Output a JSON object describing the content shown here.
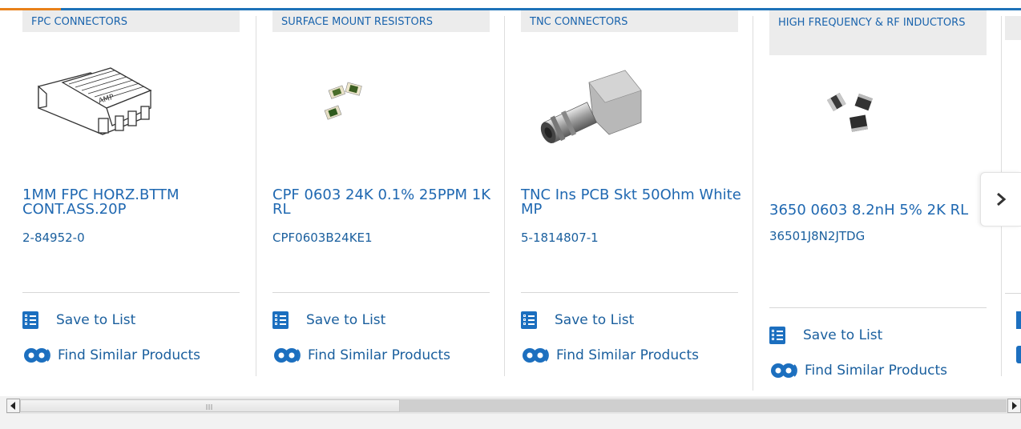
{
  "products": [
    {
      "category": "FPC CONNECTORS",
      "title": "1MM FPC HORZ.BTTM CONT.ASS.20P",
      "part_number": "2-84952-0"
    },
    {
      "category": "SURFACE MOUNT RESISTORS",
      "title": "CPF 0603 24K 0.1% 25PPM 1K RL",
      "part_number": "CPF0603B24KE1"
    },
    {
      "category": "TNC CONNECTORS",
      "title": "TNC Ins PCB Skt 50Ohm White MP",
      "part_number": "5-1814807-1"
    },
    {
      "category": "HIGH FREQUENCY & RF INDUCTORS",
      "title": "3650 0603 8.2nH 5% 2K RL",
      "part_number": "36501J8N2JTDG"
    }
  ],
  "actions": {
    "save_label": "Save to List",
    "similar_label": "Find Similar Products"
  },
  "icons": {
    "save": "checklist-icon",
    "similar": "gears-icon",
    "next": "chevron-right-icon"
  },
  "colors": {
    "accent": "#1e72b8",
    "accent_tab": "#e8811a",
    "link": "#1f68b1"
  }
}
